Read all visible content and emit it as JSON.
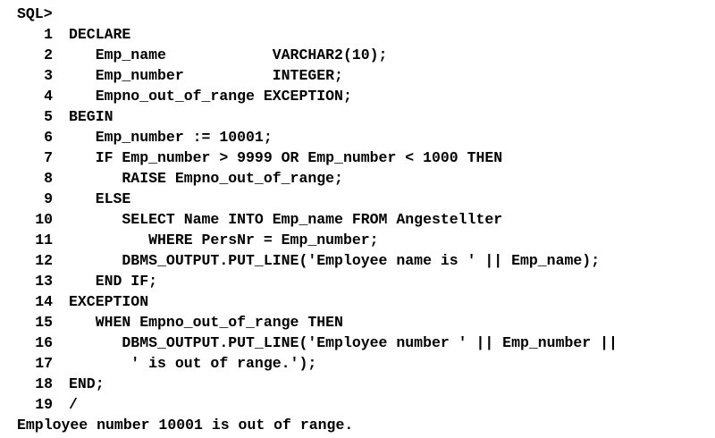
{
  "prompt": "SQL>",
  "lines": [
    {
      "num": "1",
      "text": "DECLARE"
    },
    {
      "num": "2",
      "text": "   Emp_name            VARCHAR2(10);"
    },
    {
      "num": "3",
      "text": "   Emp_number          INTEGER;"
    },
    {
      "num": "4",
      "text": "   Empno_out_of_range EXCEPTION;"
    },
    {
      "num": "5",
      "text": "BEGIN"
    },
    {
      "num": "6",
      "text": "   Emp_number := 10001;"
    },
    {
      "num": "7",
      "text": "   IF Emp_number > 9999 OR Emp_number < 1000 THEN"
    },
    {
      "num": "8",
      "text": "      RAISE Empno_out_of_range;"
    },
    {
      "num": "9",
      "text": "   ELSE"
    },
    {
      "num": "10",
      "text": "      SELECT Name INTO Emp_name FROM Angestellter"
    },
    {
      "num": "11",
      "text": "         WHERE PersNr = Emp_number;"
    },
    {
      "num": "12",
      "text": "      DBMS_OUTPUT.PUT_LINE('Employee name is ' || Emp_name);"
    },
    {
      "num": "13",
      "text": "   END IF;"
    },
    {
      "num": "14",
      "text": "EXCEPTION"
    },
    {
      "num": "15",
      "text": "   WHEN Empno_out_of_range THEN"
    },
    {
      "num": "16",
      "text": "      DBMS_OUTPUT.PUT_LINE('Employee number ' || Emp_number ||"
    },
    {
      "num": "17",
      "text": "       ' is out of range.');"
    },
    {
      "num": "18",
      "text": "END;"
    },
    {
      "num": "19",
      "text": "/"
    }
  ],
  "output": "Employee number 10001 is out of range."
}
